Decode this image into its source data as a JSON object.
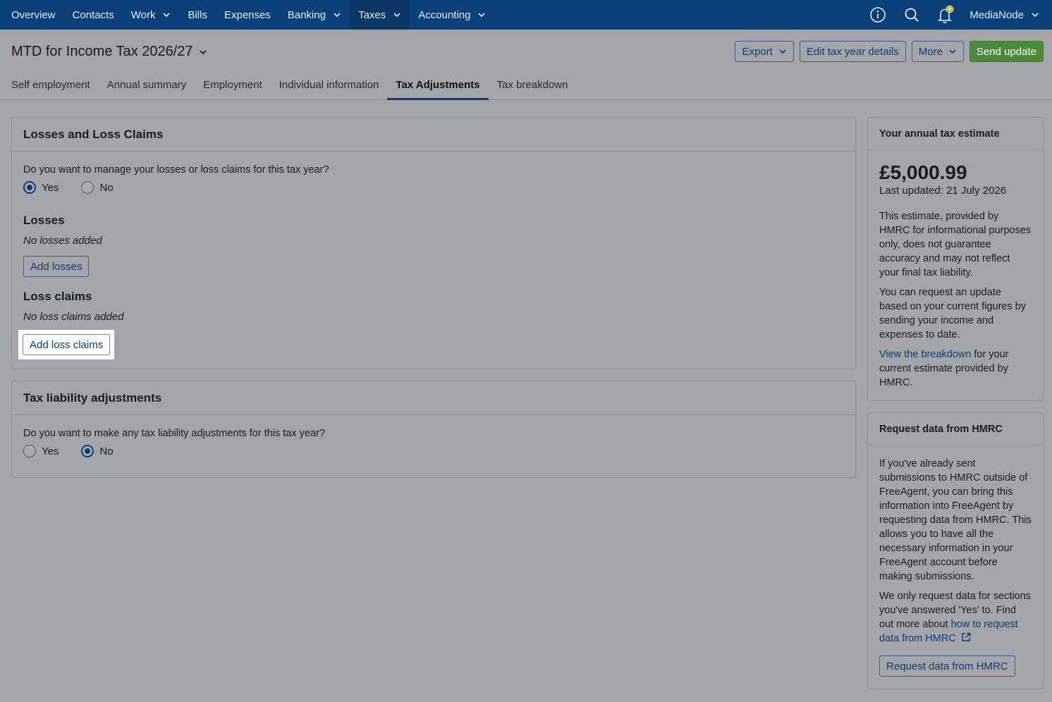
{
  "nav": {
    "items": [
      {
        "label": "Overview",
        "has_menu": false
      },
      {
        "label": "Contacts",
        "has_menu": false
      },
      {
        "label": "Work",
        "has_menu": true
      },
      {
        "label": "Bills",
        "has_menu": false
      },
      {
        "label": "Expenses",
        "has_menu": false
      },
      {
        "label": "Banking",
        "has_menu": true
      },
      {
        "label": "Taxes",
        "has_menu": true,
        "active": true
      },
      {
        "label": "Accounting",
        "has_menu": true
      }
    ],
    "org_name": "MediaNode",
    "icons": [
      "info-icon",
      "search-icon",
      "bell-icon"
    ]
  },
  "header": {
    "title": "MTD for Income Tax 2026/27",
    "export_label": "Export",
    "edit_label": "Edit tax year details",
    "more_label": "More",
    "send_label": "Send update"
  },
  "tabs": [
    {
      "label": "Self employment"
    },
    {
      "label": "Annual summary"
    },
    {
      "label": "Employment"
    },
    {
      "label": "Individual information"
    },
    {
      "label": "Tax Adjustments",
      "active": true
    },
    {
      "label": "Tax breakdown"
    }
  ],
  "losses_card": {
    "title": "Losses and Loss Claims",
    "question": "Do you want to manage your losses or loss claims for this tax year?",
    "yes": "Yes",
    "no": "No",
    "losses_title": "Losses",
    "losses_empty": "No losses added",
    "add_losses": "Add losses",
    "claims_title": "Loss claims",
    "claims_empty": "No loss claims added",
    "add_claims": "Add loss claims"
  },
  "liability_card": {
    "title": "Tax liability adjustments",
    "question": "Do you want to make any tax liability adjustments for this tax year?",
    "yes": "Yes",
    "no": "No"
  },
  "estimate_card": {
    "title": "Your annual tax estimate",
    "amount": "£5,000.99",
    "updated": "Last updated: 21 July 2026",
    "p1": "This estimate, provided by HMRC for informational purposes only, does not guarantee accuracy and may not reflect your final tax liability.",
    "p2": "You can request an update based on your current figures by sending your income and expenses to date.",
    "p3_link": "View the breakdown",
    "p3_rest": " for your current estimate provided by HMRC."
  },
  "request_card": {
    "title": "Request data from HMRC",
    "p1": "If you've already sent submissions to HMRC outside of FreeAgent, you can bring this information into FreeAgent by requesting data from HMRC. This allows you to have all the necessary information in your FreeAgent account before making submissions.",
    "p2_text": "We only request data for sections you've answered 'Yes' to. Find out more about ",
    "p2_link": "how to request data from HMRC",
    "button": "Request data from HMRC"
  }
}
